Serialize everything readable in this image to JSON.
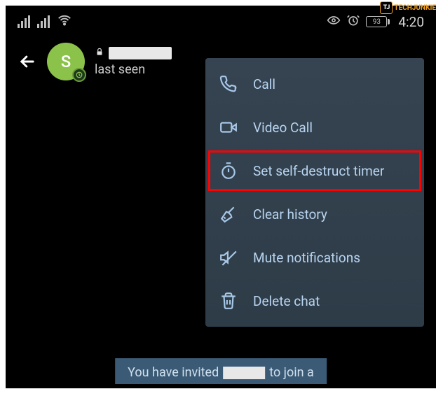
{
  "watermark": {
    "badge": "TJ",
    "text": "TECHJUNKIE"
  },
  "status_bar": {
    "battery_pct": "93",
    "time": "4:20"
  },
  "chat_header": {
    "avatar_letter": "S",
    "last_seen_label": "last seen"
  },
  "menu": {
    "items": [
      {
        "label": "Call",
        "icon": "phone"
      },
      {
        "label": "Video Call",
        "icon": "video"
      },
      {
        "label": "Set self-destruct timer",
        "icon": "timer"
      },
      {
        "label": "Clear history",
        "icon": "broom"
      },
      {
        "label": "Mute notifications",
        "icon": "mute"
      },
      {
        "label": "Delete chat",
        "icon": "trash"
      }
    ],
    "highlight_index": 2
  },
  "footer": {
    "prefix": "You have invited",
    "suffix": "to join a"
  }
}
